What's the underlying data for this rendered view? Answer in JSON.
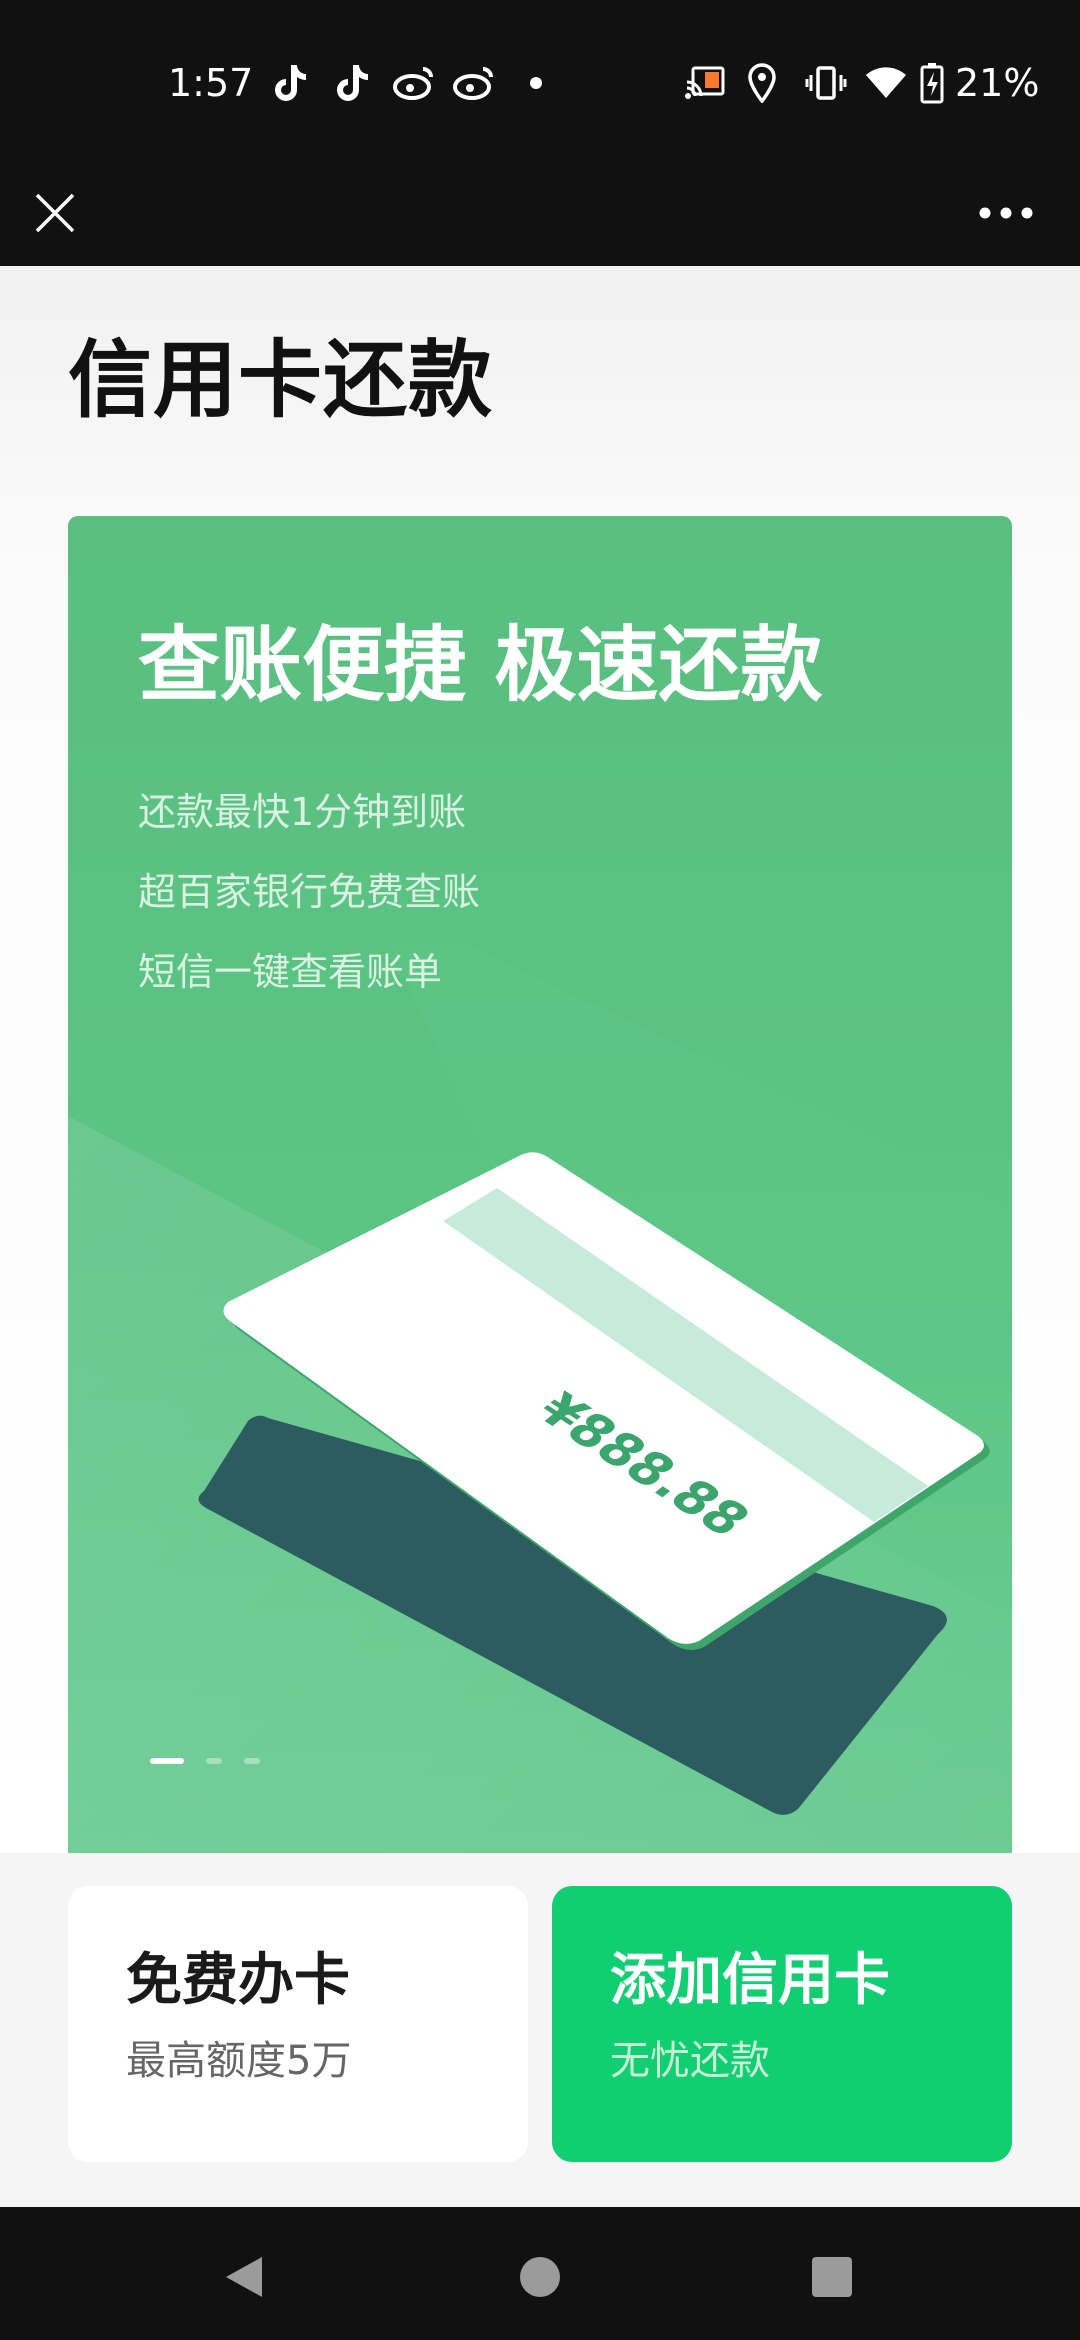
{
  "status_bar": {
    "time": "1:57",
    "icons": [
      "tiktok-icon",
      "tiktok-icon",
      "weibo-icon",
      "weibo-icon",
      "dot-icon",
      "cast-icon",
      "location-icon",
      "vibrate-icon",
      "wifi-icon",
      "battery-charging-icon"
    ],
    "battery": "21%"
  },
  "top_bar": {
    "left_icon": "close-icon",
    "right_icon": "more-icon"
  },
  "page": {
    "title": "信用卡还款"
  },
  "banner": {
    "headline": "查账便捷 极速还款",
    "features": [
      "还款最快1分钟到账",
      "超百家银行免费查账",
      "短信一键查看账单"
    ],
    "card_amount": "¥888.88",
    "page_indicator": {
      "total": 3,
      "active": 1
    }
  },
  "actions": {
    "apply": {
      "title": "免费办卡",
      "subtitle": "最高额度5万"
    },
    "add": {
      "title": "添加信用卡",
      "subtitle": "无忧还款"
    }
  },
  "colors": {
    "banner_green": "#5cc485",
    "primary_green": "#12ce72",
    "dark_card": "#2c5c60"
  },
  "nav_bar": {
    "icons": [
      "back-icon",
      "home-icon",
      "recents-icon"
    ]
  }
}
